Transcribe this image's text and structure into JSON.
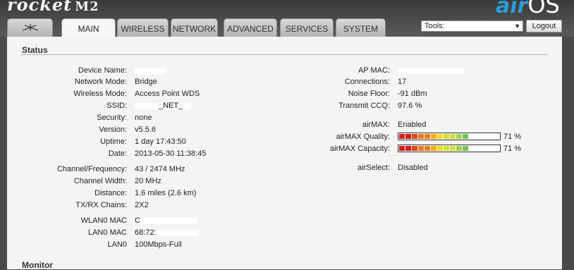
{
  "header": {
    "product_logo": "rocket",
    "product_model": "M2",
    "brand_prefix": "air",
    "brand_suffix": "OS"
  },
  "tabs": [
    {
      "label": "ubiquiti-logo-icon"
    },
    {
      "label": "MAIN",
      "active": true
    },
    {
      "label": "WIRELESS"
    },
    {
      "label": "NETWORK"
    },
    {
      "label": "ADVANCED"
    },
    {
      "label": "SERVICES"
    },
    {
      "label": "SYSTEM"
    }
  ],
  "tools": {
    "selected": "Tools:",
    "logout_label": "Logout"
  },
  "status": {
    "title": "Status",
    "left": [
      {
        "label": "Device Name:",
        "value": ""
      },
      {
        "label": "Network Mode:",
        "value": "Bridge"
      },
      {
        "label": "Wireless Mode:",
        "value": "Access Point WDS"
      },
      {
        "label": "SSID:",
        "value": "_NET_"
      },
      {
        "label": "Security:",
        "value": "none"
      },
      {
        "label": "Version:",
        "value": "v5.5.6"
      },
      {
        "label": "Uptime:",
        "value": "1 day 17:43:50"
      },
      {
        "label": "Date:",
        "value": "2013-05-30 11:38:45"
      },
      {
        "label": "Channel/Frequency:",
        "value": "43 / 2474 MHz"
      },
      {
        "label": "Channel Width:",
        "value": "20 MHz"
      },
      {
        "label": "Distance:",
        "value": "1.6 miles (2.6 km)"
      },
      {
        "label": "TX/RX Chains:",
        "value": "2X2"
      },
      {
        "label": "WLAN0 MAC",
        "value": "C"
      },
      {
        "label": "LAN0 MAC",
        "value": "68:72:"
      },
      {
        "label": "LAN0",
        "value": "100Mbps-Full"
      }
    ],
    "right": [
      {
        "label": "AP MAC:",
        "value": ""
      },
      {
        "label": "Connections:",
        "value": "17"
      },
      {
        "label": "Noise Floor:",
        "value": "-91 dBm"
      },
      {
        "label": "Transmit CCQ:",
        "value": "97.6 %"
      },
      {
        "label": "airMAX:",
        "value": "Enabled"
      },
      {
        "label": "airMAX Quality:",
        "value": "71 %",
        "level": 0.71
      },
      {
        "label": "airMAX Capacity:",
        "value": "71 %",
        "level": 0.71
      },
      {
        "label": "airSelect:",
        "value": "Disabled"
      }
    ]
  },
  "monitor": {
    "title": "Monitor"
  },
  "colors": {
    "brand_blue": "#2d9bd7",
    "bar_gradient": [
      "#d21f1f",
      "#e3431b",
      "#f07a18",
      "#f6ad16",
      "#f2d91c",
      "#cfe03a",
      "#9fd24f",
      "#74c35a"
    ]
  }
}
